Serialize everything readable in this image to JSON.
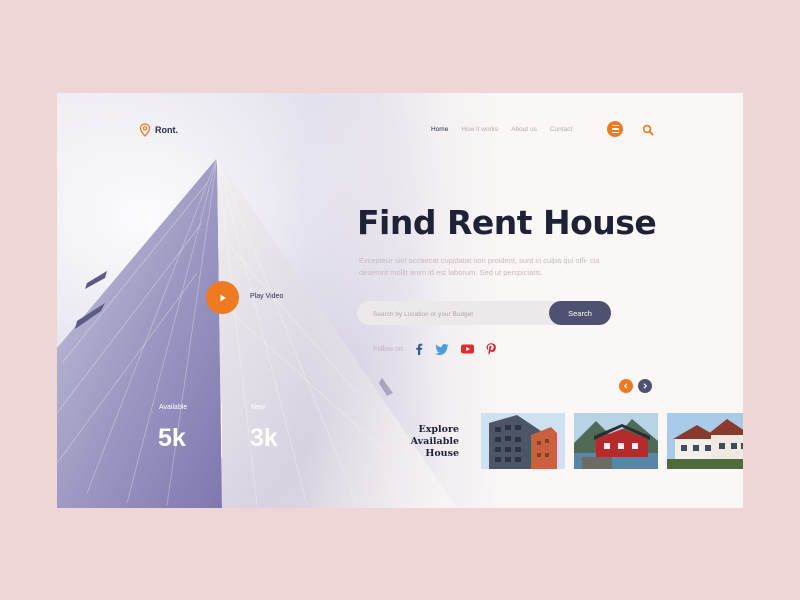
{
  "brand": {
    "name": "Ront."
  },
  "nav": {
    "items": [
      {
        "label": "Home",
        "active": true
      },
      {
        "label": "How it works",
        "active": false
      },
      {
        "label": "About us",
        "active": false
      },
      {
        "label": "Contact",
        "active": false
      }
    ]
  },
  "hero": {
    "title": "Find Rent House",
    "description": "Excepteur sint occaecat cupidatat non proident, sunt in culpa qui offi- cia deserunt mollit anim id est laborum. Sed ut perspiciatis.",
    "play_label": "Play Video"
  },
  "search": {
    "placeholder": "Search by Location or your Budget",
    "button_label": "Search"
  },
  "social": {
    "label": "Follow on",
    "icons": [
      "facebook-icon",
      "twitter-icon",
      "youtube-icon",
      "pinterest-icon"
    ]
  },
  "stats": [
    {
      "label": "Available",
      "value": "5k"
    },
    {
      "label": "New",
      "value": "3k"
    }
  ],
  "explore": {
    "line1": "Explore",
    "line2": "Available House"
  },
  "colors": {
    "accent": "#ef7a22",
    "dark": "#4f5170",
    "page_bg": "#efd6d6"
  }
}
